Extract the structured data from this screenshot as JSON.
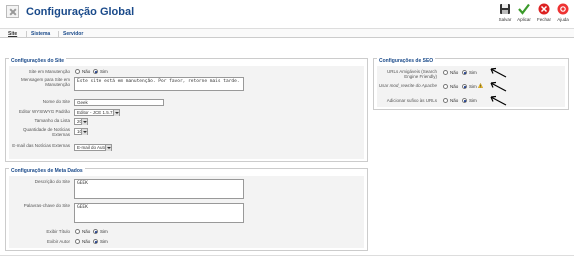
{
  "header": {
    "title": "Configuração Global"
  },
  "toolbar": {
    "save": "Salvar",
    "apply": "Aplicar",
    "close": "Fechar",
    "help": "Ajuda"
  },
  "tabs": [
    "Site",
    "Sistema",
    "Servidor"
  ],
  "site": {
    "legend": "Configurações do Site",
    "offline_label": "Site em Manutenção",
    "no": "Não",
    "yes": "Sim",
    "offline_msg_label": "Mensagem para Site em Manutenção",
    "offline_msg_value": "Este site está em manutenção. Por favor, retorne mais tarde.",
    "sitename_label": "Nome do Site",
    "sitename_value": "Geek",
    "editor_label": "Editor WYSIWYG Padrão",
    "editor_value": "Editor - JCE 1.5.7.4",
    "listlength_label": "Tamanho da Lista",
    "listlength_value": "20",
    "feed_label": "Quantidade de Notícias Externas",
    "feed_value": "10",
    "feedemail_label": "E-mail das Notícias Externas",
    "feedemail_value": "E-mail do Autor"
  },
  "meta": {
    "legend": "Configurações de Meta Dados",
    "desc_label": "Descrição do Site",
    "desc_value": "GEEK",
    "keys_label": "Palavras-chave do Site",
    "keys_value": "GEEK",
    "title_label": "Exibir Título",
    "author_label": "Exibir Autor",
    "no": "Não",
    "yes": "Sim"
  },
  "seo": {
    "legend": "Configurações de SEO",
    "sef_label": "URLs Amigáveis (Search Engine Friendly)",
    "rewrite_label": "Usar mod_rewrite do Apache",
    "suffix_label": "Adicionar sufixo às URLs",
    "no": "Não",
    "yes": "Sim"
  }
}
